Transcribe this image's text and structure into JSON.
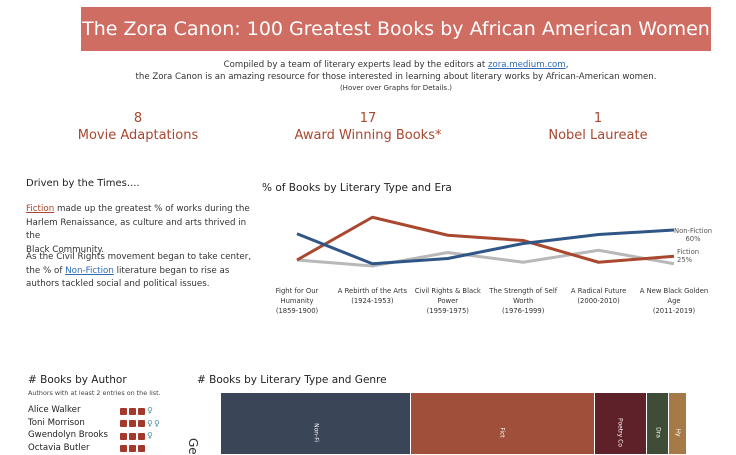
{
  "banner": {
    "title": "The Zora Canon: 100 Greatest Books by African American Women"
  },
  "intro": {
    "line1_prefix": "Compiled by a team of literary experts lead by the editors at ",
    "line1_link": "zora.medium.com",
    "line1_suffix": ",",
    "line2": "the Zora Canon is an amazing resource for those interested in learning about literary works by African-American women.",
    "line3": "(Hover over Graphs for Details.)"
  },
  "kpis": [
    {
      "value": "8",
      "label": "Movie Adaptations"
    },
    {
      "value": "17",
      "label": "Award Winning Books*"
    },
    {
      "value": "1",
      "label": "Nobel Laureate"
    }
  ],
  "driven": {
    "title": "Driven by the Times....",
    "p1_link": "Fiction",
    "p1_rest_line1": " made up the greatest % of works during the",
    "p1_line2": "Harlem Renaissance, as culture and arts thrived in the",
    "p1_line3": "Black Community.",
    "p2_line1": "As the Civil Rights movement began to take center,",
    "p2_prefix": "the % of ",
    "p2_link": "Non-Fiction",
    "p2_suffix": " literature began to rise as",
    "p2_line3": "authors tackled social and political issues."
  },
  "chart_data": {
    "type": "line",
    "title": "% of Books by Literary Type and Era",
    "categories": [
      [
        "Fight for Our",
        "Humanity",
        "(1859-1900)"
      ],
      [
        "A Rebirth of the Arts",
        "(1924-1953)"
      ],
      [
        "Civil Rights & Black",
        "Power",
        "(1959-1975)"
      ],
      [
        "The Strength of Self",
        "Worth",
        "(1976-1999)"
      ],
      [
        "A Radical Future",
        "(2000-2010)"
      ],
      [
        "A New Black Golden",
        "Age",
        "(2011-2019)"
      ]
    ],
    "series": [
      {
        "name": "Non-Fiction",
        "color": "#2f5687",
        "values": [
          55,
          15,
          22,
          42,
          54,
          60
        ]
      },
      {
        "name": "Fiction",
        "color": "#a9472f",
        "values": [
          20,
          77,
          53,
          46,
          17,
          25
        ]
      },
      {
        "name": "",
        "color": "#b8b8b8",
        "values": [
          20,
          12,
          30,
          17,
          33,
          15
        ]
      }
    ],
    "end_labels": [
      {
        "name": "Non-Fiction",
        "value": "60%"
      },
      {
        "name": "Fiction",
        "value": "25%"
      }
    ],
    "ylim": [
      0,
      100
    ],
    "grid": false
  },
  "authors": {
    "title": "# Books by Author",
    "subtitle": "Authors with at least 2 entries on the list.",
    "rows": [
      {
        "name": "Alice Walker",
        "books": 3,
        "awards": 1
      },
      {
        "name": "Toni Morrison",
        "books": 3,
        "awards": 2
      },
      {
        "name": "Gwendolyn Brooks",
        "books": 3,
        "awards": 1
      },
      {
        "name": "Octavia Butler",
        "books": 3,
        "awards": 0
      }
    ],
    "colors": {
      "book": "#a4382a",
      "award": "#4a8da0"
    }
  },
  "genre": {
    "title": "# Books by Literary Type and Genre",
    "axis_label": "Ge",
    "blocks": [
      {
        "label": "Non-Fi",
        "color": "#3b4558",
        "share": 0.408
      },
      {
        "label": "Fict",
        "color": "#a0503a",
        "share": 0.394
      },
      {
        "label": "Poetry Co",
        "color": "#5e2029",
        "share": 0.112
      },
      {
        "label": "Dra",
        "color": "#3f4c37",
        "share": 0.048
      },
      {
        "label": "Hy",
        "color": "#a57a47",
        "share": 0.038
      }
    ]
  },
  "colors": {
    "banner": "#cf6d63",
    "accent": "#a9472f",
    "link": "#2d6bb6"
  }
}
